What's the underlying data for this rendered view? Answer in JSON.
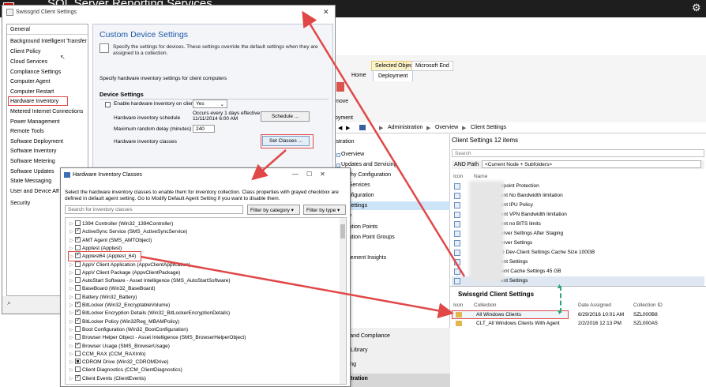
{
  "topbar": {
    "title": "SQL Server Reporting Services",
    "gear": "⚙"
  },
  "ribbon": {
    "selected_object": "Selected Object",
    "microsoft_end": "Microsoft End",
    "home": "Home",
    "deployment": "Deployment",
    "frag_remove": "move",
    "frag_deploy": "oyment"
  },
  "navbar": {
    "crumbs": [
      "Administration",
      "Overview",
      "Client Settings"
    ],
    "sep": "▶"
  },
  "wunderbar": {
    "header": "istration",
    "items": [
      "Overview",
      "Updates and Servicing",
      "rarchy Configuration",
      "ud Services",
      "Configuration",
      "nt Settings",
      "urity",
      "tribution Points",
      "tribution Point Groups",
      "nagement Insights"
    ],
    "lower": [
      "ets and Compliance",
      "are Library",
      "itoring",
      "inistration"
    ]
  },
  "list": {
    "header": "Client Settings 12 items",
    "search_placeholder": "Search",
    "and_path": "AND Path",
    "and_path_value": "<Current Node + Subfolders>",
    "col_icon": "Icon",
    "col_name": "Name",
    "rows": [
      "dpoint Protection",
      "ent No Bandwidth limitation",
      "ent IPU Policy",
      "ent VPN Bandwidth limitation",
      "ent no BITS limits",
      "erver Settings After Staging",
      "erver Settings",
      "D Dev-Client Settings Cache Size 100GB",
      "ent Settings",
      "ient Cache Settings 45 GB",
      "ent Settings"
    ]
  },
  "detail": {
    "title": "Swissgrid Client Settings",
    "col_icon": "Icon",
    "col_collection": "Collection",
    "col_date": "Date Assigned",
    "col_id": "Collection ID",
    "rows": [
      {
        "collection": "All Windows Clients",
        "date": "6/29/2016 10:01 AM",
        "id": "SZL000B8"
      },
      {
        "collection": "CLT_All Windows Clients With Agent",
        "date": "2/2/2016 12:13 PM",
        "id": "SZL000A5"
      }
    ]
  },
  "dialog1": {
    "title": "Swissgrid Client Settings",
    "close": "✕",
    "nav": [
      "General",
      "Background Intelligent Transfer",
      "Client Policy",
      "Cloud Services",
      "Compliance Settings",
      "Computer Agent",
      "Computer Restart",
      "Hardware Inventory",
      "Metered Internet Connections",
      "Power Management",
      "Remote Tools",
      "Software Deployment",
      "Software Inventory",
      "Software Metering",
      "Software Updates",
      "State Messaging",
      "User and Device Affinity",
      "Security"
    ],
    "content_title": "Custom Device Settings",
    "content_desc": "Specify the settings for devices. These settings override the default settings when they are assigned to a collection.",
    "hw_desc": "Specify hardware inventory settings for client computers",
    "device_settings": "Device Settings",
    "enable_label": "Enable hardware inventory on clients",
    "enable_value": "Yes",
    "schedule_label": "Hardware inventory schedule",
    "occurs": "Occurs every 1 days effective",
    "occurs_date": "11/11/2014 6:00 AM",
    "schedule_btn": "Schedule ...",
    "delay_label": "Maximum random delay (minutes)",
    "delay_value": "240",
    "classes_label": "Hardware inventory classes",
    "set_classes_btn": "Set Classes ..."
  },
  "dialog2": {
    "title": "Hardware Inventory Classes",
    "window_controls": "—☐✕",
    "desc": "Select the hardware inventory classes to enable them for inventory collection. Class properties with grayed checkbox are defined in default agent setting. Go to Modify Default Agent Setting if you want to disable them.",
    "search_placeholder": "Search for inventory classes",
    "filter_category": "Filter by category ▾",
    "filter_type": "Filter by type ▾",
    "classes": [
      {
        "label": "1394 Controller (Win32_1394Controller)",
        "state": "off"
      },
      {
        "label": "ActiveSync Service (SMS_ActiveSyncService)",
        "state": "on"
      },
      {
        "label": "AMT Agent (SMS_AMTObject)",
        "state": "on"
      },
      {
        "label": "Apptest (Apptest)",
        "state": "off"
      },
      {
        "label": "Apptest64 (Apptest_64)",
        "state": "on"
      },
      {
        "label": "AppV Client Application (AppvClientApplication)",
        "state": "off"
      },
      {
        "label": "AppV Client Package (AppvClientPackage)",
        "state": "off"
      },
      {
        "label": "AutoStart Software - Asset Intelligence (SMS_AutoStartSoftware)",
        "state": "off"
      },
      {
        "label": "BaseBoard (Win32_BaseBoard)",
        "state": "off"
      },
      {
        "label": "Battery (Win32_Battery)",
        "state": "off"
      },
      {
        "label": "BitLocker (Win32_EncryptableVolume)",
        "state": "on"
      },
      {
        "label": "BitLocker Encryption Details (Win32_BitLockerEncryptionDetails)",
        "state": "on"
      },
      {
        "label": "BitLocker Policy (Win32Reg_MBAMPolicy)",
        "state": "on"
      },
      {
        "label": "Boot Configuration (Win32_BootConfiguration)",
        "state": "off"
      },
      {
        "label": "Browser Helper Object - Asset Intelligence (SMS_BrowserHelperObject)",
        "state": "off"
      },
      {
        "label": "Browser Usage (SMS_BrowserUsage)",
        "state": "on"
      },
      {
        "label": "CCM_RAX (CCM_RAXInfo)",
        "state": "off"
      },
      {
        "label": "CDROM Drive (Win32_CDROMDrive)",
        "state": "fill"
      },
      {
        "label": "Client Diagnostics (CCM_ClientDiagnostics)",
        "state": "off"
      },
      {
        "label": "Client Events (ClientEvents)",
        "state": "on"
      }
    ]
  },
  "colors": {
    "annotation": "#e04848",
    "accent": "#1c5aa8",
    "connector": "#2ea67a"
  }
}
